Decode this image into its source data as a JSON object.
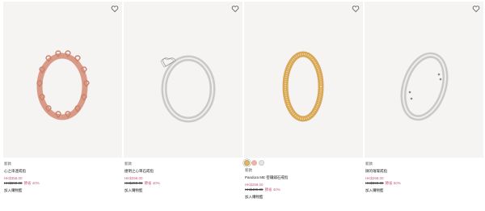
{
  "products": [
    {
      "badge": "新款",
      "name": "心之串連戒指",
      "sale_price": "HK$359.00",
      "original_price": "HK$599.00",
      "discount": "節省 40%",
      "add_to_cart": "加入購物籃",
      "finish": "rose-gold",
      "ring_color": "#d99b87"
    },
    {
      "badge": "新款",
      "name": "捷明之心單石戒指",
      "sale_price": "HK$299.00",
      "original_price": "HK$499.00",
      "discount": "節省 40%",
      "add_to_cart": "加入購物籃",
      "finish": "silver",
      "ring_color": "#c9c9c9"
    },
    {
      "badge": "新款",
      "name": "Pandora ME 密鑲鋪石戒指",
      "sale_price": "HK$299.00",
      "original_price": "HK$499.00",
      "discount": "節省 40%",
      "add_to_cart": "加入購物籃",
      "finish": "gold",
      "ring_color": "#d8a858",
      "swatches": [
        "gold",
        "rose",
        "silver"
      ]
    },
    {
      "badge": "新款",
      "name": "微的璀璨戒指",
      "sale_price": "HK$299.00",
      "original_price": "HK$599.00",
      "discount": "節省 50%",
      "add_to_cart": "加入購物籃",
      "finish": "silver",
      "ring_color": "#c9c9c9"
    }
  ]
}
